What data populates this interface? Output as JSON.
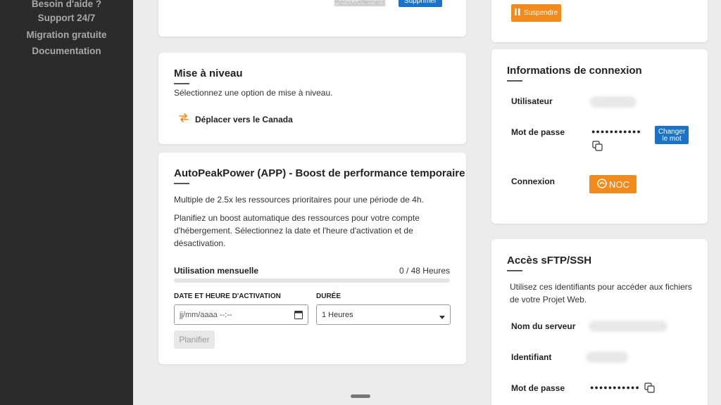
{
  "sidebar": {
    "links": [
      "Besoin d'aide ?",
      "Support 24/7",
      "Migration gratuite",
      "Documentation"
    ]
  },
  "top_card": {
    "link_text": "Renouvellement",
    "button_label": "Supprimer"
  },
  "upgrade": {
    "title": "Mise à niveau",
    "description": "Sélectionnez une option de mise à niveau.",
    "option_label": "Déplacer vers le Canada",
    "option_icon": "swap-arrows-icon"
  },
  "boost": {
    "title": "AutoPeakPower (APP) - Boost de performance temporaire",
    "para1": "Multiple de 2.5x les ressources prioritaires pour une période de 4h.",
    "para2": "Planifiez un boost automatique des ressources pour votre compte d'hébergement. Sélectionnez la date et l'heure d'activation et de désactivation.",
    "usage_label": "Utilisation mensuelle",
    "usage_value": "0 / 48 Heures",
    "usage_fraction": 0,
    "date_label": "DATE ET HEURE D'ACTIVATION",
    "date_placeholder": "jj/mm/aaaa --:--",
    "duration_label": "DURÉE",
    "duration_selected": "1 Heures",
    "schedule_button": "Planifier"
  },
  "suspend": {
    "button_label": "Suspendre"
  },
  "connection": {
    "title": "Informations de connexion",
    "user_label": "Utilisateur",
    "password_label": "Mot de passe",
    "password_mask": "●●●●●●●●●●●",
    "change_button": "Changer le mot",
    "login_label": "Connexion",
    "noc_label": "NOC"
  },
  "sftp": {
    "title": "Accès sFTP/SSH",
    "description": "Utilisez ces identifiants pour accéder aux fichiers de votre Projet Web.",
    "server_label": "Nom du serveur",
    "id_label": "Identifiant",
    "password_label": "Mot de passe",
    "password_mask": "●●●●●●●●●●●"
  },
  "colors": {
    "accent_blue": "#1a73c6",
    "accent_orange": "#f28a1c",
    "sidebar_bg": "#2b2b2b"
  }
}
